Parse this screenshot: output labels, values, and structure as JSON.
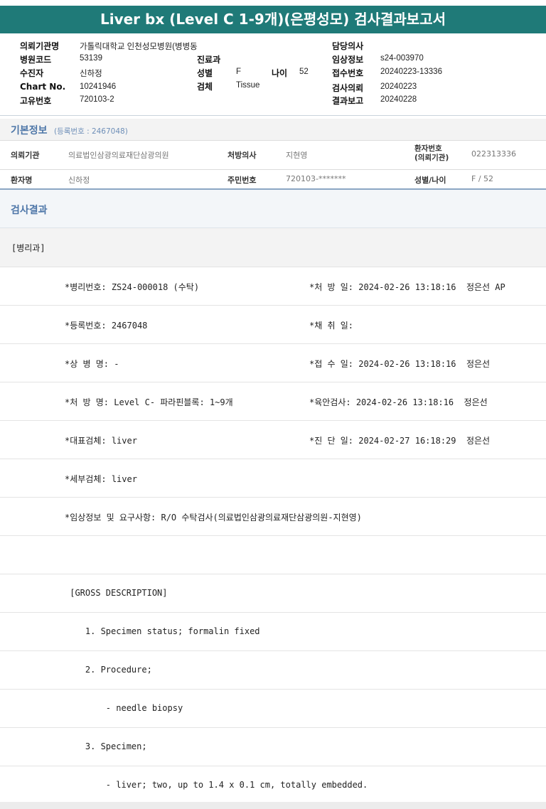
{
  "title": "Liver bx (Level C 1-9개)(은평성모) 검사결과보고서",
  "header": {
    "org_label": "의뢰기관명",
    "org_value": "가톨릭대학교 인천성모병원(병병동",
    "doctor_label": "담당의사",
    "doctor_value": "",
    "code_label": "병원코드",
    "code_value": "53139",
    "dept_label": "진료과",
    "dept_value": "",
    "clinical_label": "임상정보",
    "clinical_value": "s24-003970",
    "patient_label": "수진자",
    "patient_value": "신하정",
    "sex_label": "성별",
    "sex_value": "F",
    "age_label": "나이",
    "age_value": "52",
    "receipt_label": "접수번호",
    "receipt_value": "20240223-13336",
    "chart_label": "Chart No.",
    "chart_value": "10241946",
    "specimen_label": "검체",
    "specimen_value": "Tissue",
    "request_label": "검사의뢰",
    "request_value": "20240223",
    "uid_label": "고유번호",
    "uid_value": "720103-2",
    "report_label": "결과보고",
    "report_value": "20240228"
  },
  "basic": {
    "title": "기본정보",
    "subtitle": "(등록번호 : 2467048)",
    "org_label": "의뢰기관",
    "org_value": "의료법인삼광의료재단삼광의원",
    "doctor_label": "처방의사",
    "doctor_value": "지현영",
    "pid_label_1": "환자번호",
    "pid_label_2": "(의뢰기관)",
    "pid_value": "022313336",
    "name_label": "환자명",
    "name_value": "신하정",
    "rrn_label": "주민번호",
    "rrn_value": "720103-*******",
    "sexage_label": "성별/나이",
    "sexage_value": "F / 52"
  },
  "results": {
    "title": "검사결과",
    "dept": "[병리과]",
    "lines": [
      {
        "left": "*병리번호: ZS24-000018 (수탁)",
        "right": "*처 방 일: 2024-02-26 13:18:16  정은선 AP"
      },
      {
        "left": "*등록번호: 2467048",
        "right": "*채 취 일:"
      },
      {
        "left": "*상 병 명: -",
        "right": "*접 수 일: 2024-02-26 13:18:16  정은선"
      },
      {
        "left": "*처 방 명: Level C- 파라핀블록: 1~9개",
        "right": "*육안검사: 2024-02-26 13:18:16  정은선"
      },
      {
        "left": "*대표검체: liver",
        "right": "*진 단 일: 2024-02-27 16:18:29  정은선"
      },
      {
        "left": "*세부검체: liver",
        "right": ""
      },
      {
        "left": "*임상정보 및 요구사항: R/O 수탁검사(의료법인삼광의료재단삼광의원-지현영)",
        "right": ""
      },
      {
        "left": "",
        "right": ""
      },
      {
        "left": " [GROSS DESCRIPTION]",
        "right": ""
      },
      {
        "left": "    1. Specimen status; formalin fixed",
        "right": ""
      },
      {
        "left": "    2. Procedure;",
        "right": ""
      },
      {
        "left": "        - needle biopsy",
        "right": ""
      },
      {
        "left": "    3. Specimen;",
        "right": ""
      },
      {
        "left": "        - liver; two, up to 1.4 x 0.1 cm, totally embedded.",
        "right": ""
      }
    ]
  }
}
